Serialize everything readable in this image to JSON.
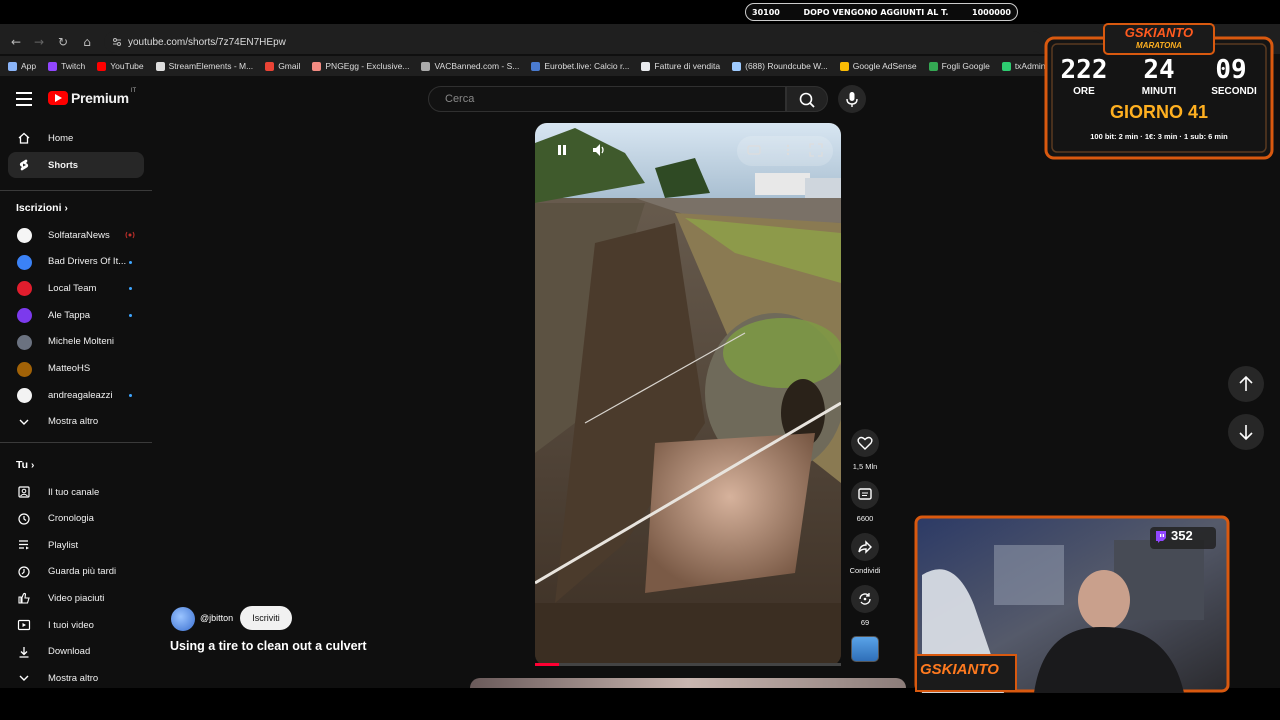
{
  "stream_overlay": {
    "ticker": {
      "left_value": "30100",
      "message": "DOPO VENGONO AGGIUNTI AL T.",
      "right_value": "1000000"
    },
    "timer": {
      "brand": "GSKIANTO",
      "subtitle": "MARATONA",
      "hours": "222",
      "minutes": "24",
      "seconds": "09",
      "hours_label": "ORE",
      "minutes_label": "MINUTI",
      "seconds_label": "SECONDI",
      "day": "GIORNO 41",
      "rules": "100 bit: 2 min · 1€: 3 min · 1 sub: 6 min"
    },
    "webcam": {
      "viewer_count": "352",
      "brand": "GSKIANTO"
    }
  },
  "browser": {
    "url": "youtube.com/shorts/7z74EN7HEpw",
    "bookmarks": [
      {
        "label": "App",
        "color": "#8ab4f8"
      },
      {
        "label": "Twitch",
        "color": "#9146ff"
      },
      {
        "label": "YouTube",
        "color": "#ff0000"
      },
      {
        "label": "StreamElements - M...",
        "color": "#dddddd"
      },
      {
        "label": "Gmail",
        "color": "#ea4335"
      },
      {
        "label": "PNGEgg - Exclusive...",
        "color": "#f28b82"
      },
      {
        "label": "VACBanned.com - S...",
        "color": "#aaaaaa"
      },
      {
        "label": "Eurobet.live: Calcio r...",
        "color": "#4a7bd0"
      },
      {
        "label": "Fatture di vendita",
        "color": "#e8eaed"
      },
      {
        "label": "(688) Roundcube W...",
        "color": "#9ecbff"
      },
      {
        "label": "Google AdSense",
        "color": "#fbbc04"
      },
      {
        "label": "Fogli Google",
        "color": "#34a853"
      },
      {
        "label": "txAdmin",
        "color": "#2ecc71"
      }
    ]
  },
  "header": {
    "logo": "Premium",
    "logo_region": "IT",
    "search_placeholder": "Cerca"
  },
  "sidebar": {
    "main": [
      {
        "label": "Home",
        "icon": "home-icon"
      },
      {
        "label": "Shorts",
        "icon": "shorts-icon",
        "active": true
      }
    ],
    "subscriptions_heading": "Iscrizioni",
    "subscriptions": [
      {
        "label": "SolfataraNews",
        "color": "#f5f5f5",
        "live": true
      },
      {
        "label": "Bad Drivers Of It...",
        "color": "#3b82f6",
        "dot": true
      },
      {
        "label": "Local Team",
        "color": "#e11d2d",
        "dot": true
      },
      {
        "label": "Ale Tappa",
        "color": "#7c3aed",
        "dot": true
      },
      {
        "label": "Michele Molteni",
        "color": "#6b7280"
      },
      {
        "label": "MatteoHS",
        "color": "#a16207"
      },
      {
        "label": "andreagaleazzi",
        "color": "#f3f3f3",
        "dot": true
      },
      {
        "label": "Mostra altro",
        "icon": "chevron-down-icon"
      }
    ],
    "you_heading": "Tu",
    "you": [
      {
        "label": "Il tuo canale",
        "icon": "channel-icon"
      },
      {
        "label": "Cronologia",
        "icon": "history-icon"
      },
      {
        "label": "Playlist",
        "icon": "playlist-icon"
      },
      {
        "label": "Guarda più tardi",
        "icon": "watch-later-icon"
      },
      {
        "label": "Video piaciuti",
        "icon": "thumbs-up-icon"
      },
      {
        "label": "I tuoi video",
        "icon": "your-videos-icon"
      },
      {
        "label": "Download",
        "icon": "download-icon"
      },
      {
        "label": "Mostra altro",
        "icon": "chevron-down-icon"
      }
    ]
  },
  "short": {
    "channel": "@jbitton",
    "subscribe_label": "Iscriviti",
    "title": "Using a tire to clean out a culvert",
    "likes": "1,5 Mln",
    "comments": "6600",
    "share_label": "Condividi",
    "remix_count": "69",
    "progress": 0.08
  }
}
